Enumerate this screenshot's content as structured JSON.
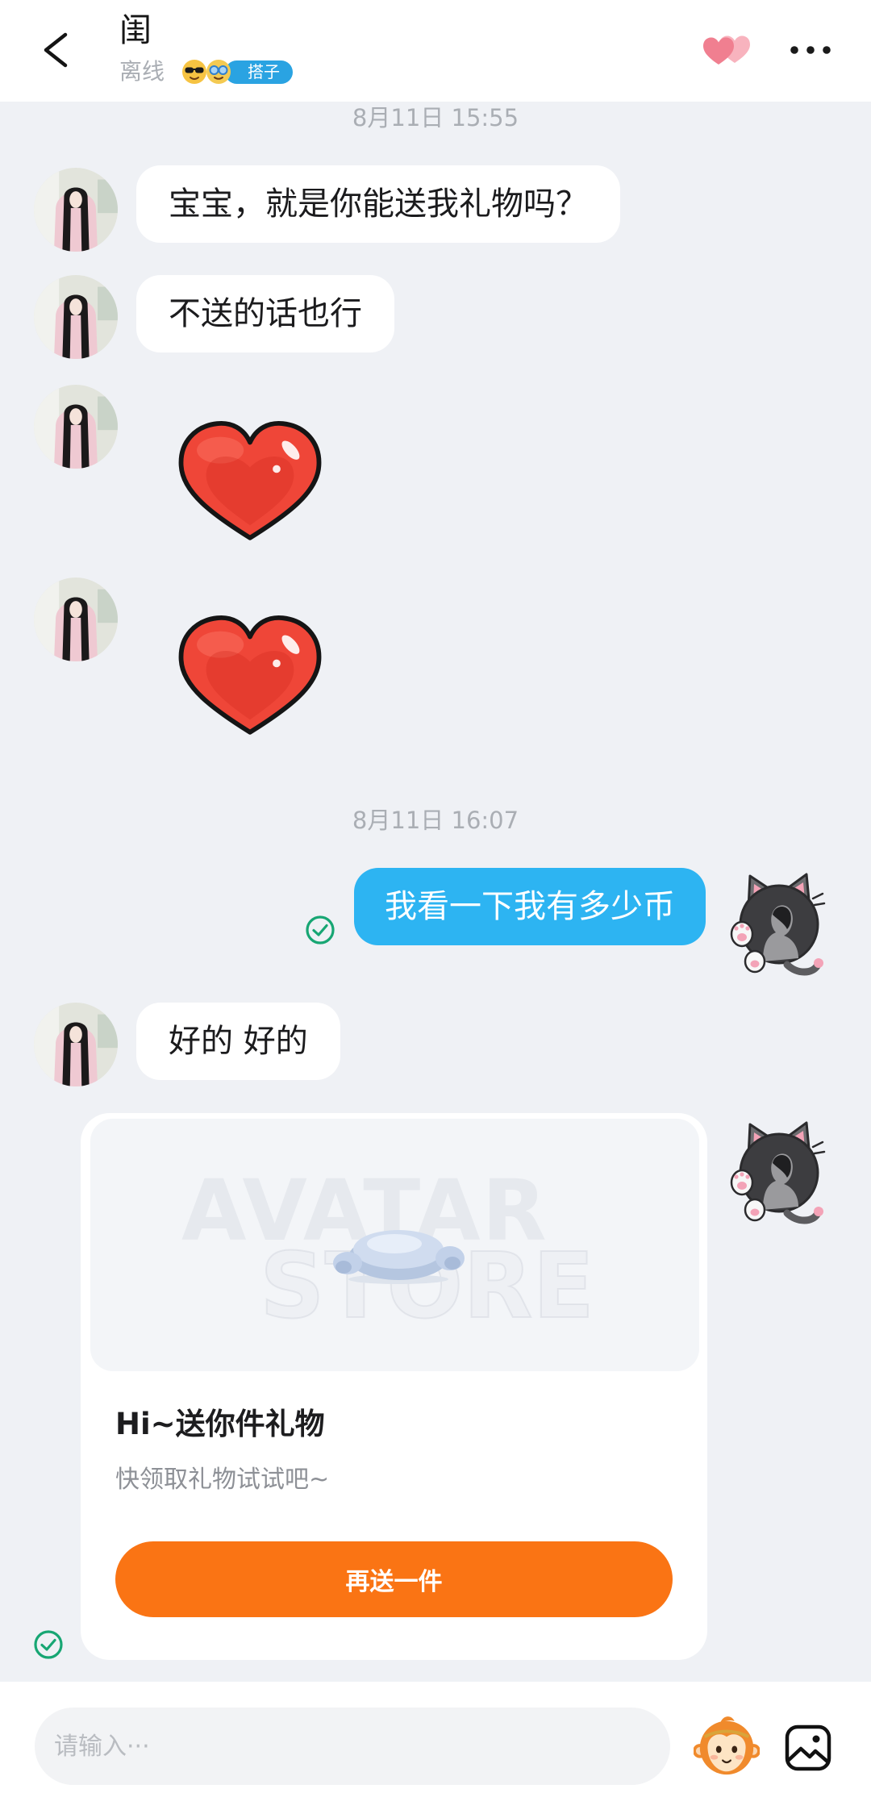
{
  "header": {
    "back_icon": "chevron-left-icon",
    "contact_name": "闺",
    "status": "离线",
    "emoji_icons": [
      "sunglasses-emoji-icon",
      "glasses-emoji-icon"
    ],
    "badge_label": "搭子",
    "intimacy_icon": "double-heart-icon",
    "more_icon": "more-dots-icon"
  },
  "chat": {
    "timestamps": [
      "8月11日 15:55",
      "8月11日 16:07"
    ],
    "incoming": [
      "宝宝，就是你能送我礼物吗？",
      "不送的话也行",
      "好的 好的"
    ],
    "outgoing": [
      "我看一下我有多少币"
    ],
    "sticker_icon": "red-heart-sticker",
    "status_icon": "delivered-check-icon",
    "contact_avatar_icon": "contact-photo-avatar-icon",
    "my_avatar_icon": "cat-frame-avatar-icon"
  },
  "gift_card": {
    "watermark": [
      "AVATAR",
      "STORE"
    ],
    "item_icon": "blue-plush-toy-icon",
    "title": "Hi~送你件礼物",
    "subtitle": "快领取礼物试试吧~",
    "button_label": "再送一件"
  },
  "composer": {
    "placeholder": "请输入···",
    "emoji_icon": "monkey-face-icon",
    "image_icon": "image-icon"
  },
  "colors": {
    "page_bg": "#eff1f5",
    "header_bg": "#ffffff",
    "incoming_bubble": "#ffffff",
    "outgoing_bubble": "#2db4f2",
    "badge": "#2aa3e2",
    "action_orange": "#fa7414",
    "check_green": "#17a673",
    "muted_text": "#aaaeb4"
  }
}
